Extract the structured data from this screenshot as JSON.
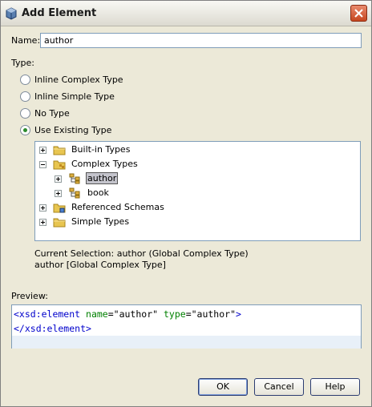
{
  "window": {
    "title": "Add Element",
    "close_icon": "close-icon",
    "app_icon": "cube-icon"
  },
  "name_field": {
    "label": "Name:",
    "value": "author"
  },
  "type": {
    "label": "Type:",
    "options": [
      {
        "label": "Inline Complex Type",
        "checked": false
      },
      {
        "label": "Inline Simple Type",
        "checked": false
      },
      {
        "label": "No Type",
        "checked": false
      },
      {
        "label": "Use Existing Type",
        "checked": true
      }
    ]
  },
  "tree": {
    "items": [
      {
        "label": "Built-in Types",
        "expanded": false,
        "icon": "folder-icon"
      },
      {
        "label": "Complex Types",
        "expanded": true,
        "icon": "folder-icon"
      },
      {
        "label": "author",
        "expanded": false,
        "icon": "complex-type-icon",
        "selected": true
      },
      {
        "label": "book",
        "expanded": false,
        "icon": "complex-type-icon"
      },
      {
        "label": "Referenced Schemas",
        "expanded": false,
        "icon": "folder-icon"
      },
      {
        "label": "Simple Types",
        "expanded": false,
        "icon": "folder-icon"
      }
    ]
  },
  "selection": {
    "line1": "Current Selection: author (Global Complex Type)",
    "line2": "author [Global Complex Type]"
  },
  "preview": {
    "label": "Preview:",
    "open_tag": "<xsd:element",
    "attr1_name": "name",
    "attr1_value": "=\"author\"",
    "attr2_name": "type",
    "attr2_value": "=\"author\"",
    "open_close": ">",
    "close_tag": "</xsd:element>"
  },
  "buttons": {
    "ok": "OK",
    "cancel": "Cancel",
    "help": "Help"
  }
}
